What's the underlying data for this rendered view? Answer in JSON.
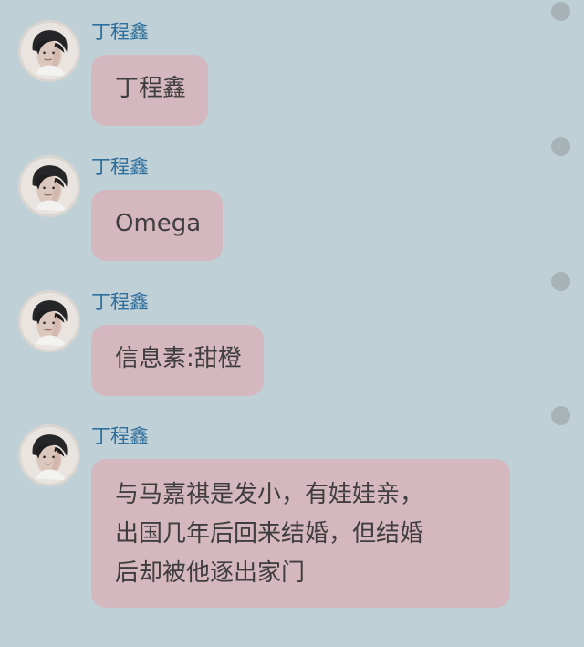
{
  "messages": [
    {
      "sender": "丁程鑫",
      "text": [
        "丁程鑫"
      ]
    },
    {
      "sender": "丁程鑫",
      "text": [
        "Omega"
      ]
    },
    {
      "sender": "丁程鑫",
      "text": [
        "信息素:甜橙"
      ]
    },
    {
      "sender": "丁程鑫",
      "text": [
        "与马嘉祺是发小，有娃娃亲，",
        "出国几年后回来结婚，但结婚",
        "后却被他逐出家门"
      ]
    }
  ],
  "colors": {
    "background": "#bfd0d7",
    "bubble": "#d5b8bf",
    "sender_name": "#2f6f9c",
    "message_text": "#3f3d3d",
    "status_dot": "#a8b3b7"
  }
}
